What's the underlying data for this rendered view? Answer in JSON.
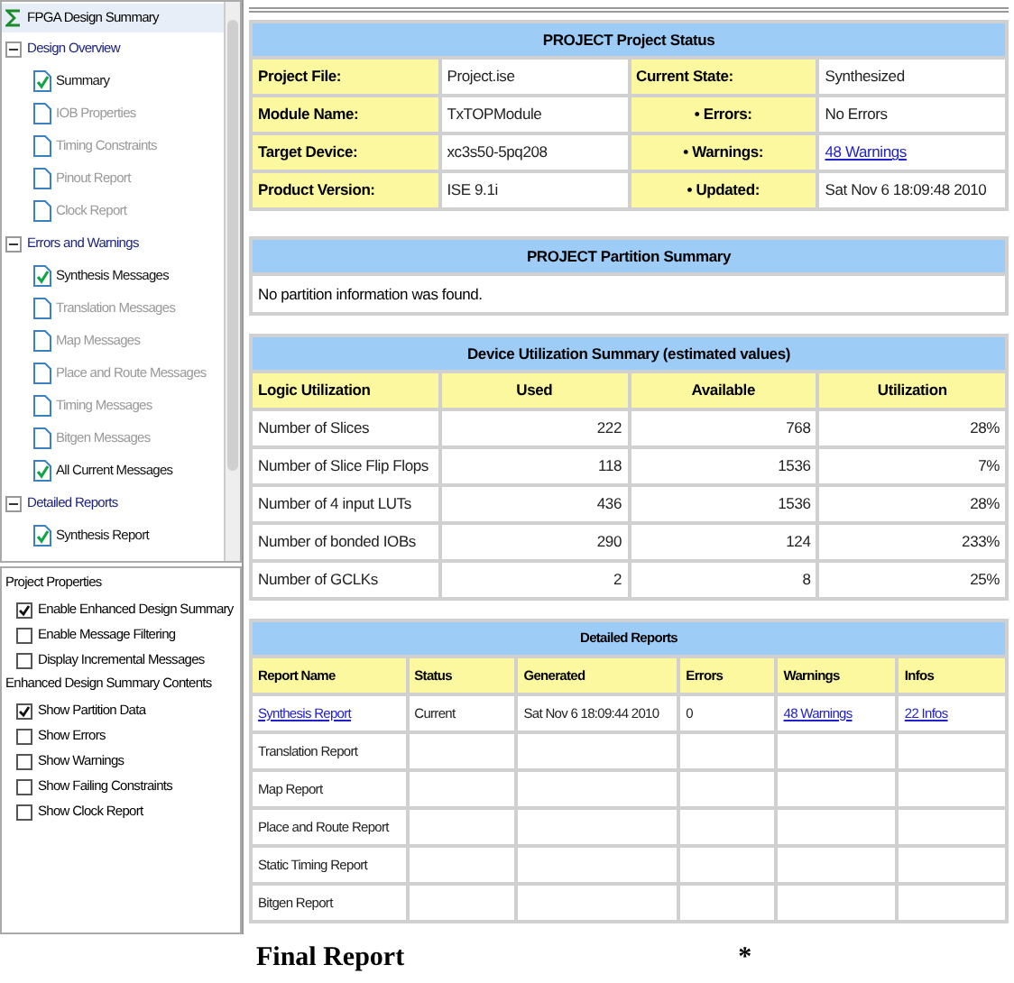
{
  "tree": {
    "header": "FPGA Design Summary",
    "groups": [
      {
        "label": "Design Overview",
        "expanded": true,
        "children": [
          {
            "label": "Summary",
            "checked": true,
            "disabled": false
          },
          {
            "label": "IOB Properties",
            "checked": false,
            "disabled": true
          },
          {
            "label": "Timing Constraints",
            "checked": false,
            "disabled": true
          },
          {
            "label": "Pinout Report",
            "checked": false,
            "disabled": true
          },
          {
            "label": "Clock Report",
            "checked": false,
            "disabled": true
          }
        ]
      },
      {
        "label": "Errors and Warnings",
        "expanded": true,
        "children": [
          {
            "label": "Synthesis Messages",
            "checked": true,
            "disabled": false
          },
          {
            "label": "Translation Messages",
            "checked": false,
            "disabled": true
          },
          {
            "label": "Map Messages",
            "checked": false,
            "disabled": true
          },
          {
            "label": "Place and Route Messages",
            "checked": false,
            "disabled": true
          },
          {
            "label": "Timing Messages",
            "checked": false,
            "disabled": true
          },
          {
            "label": "Bitgen Messages",
            "checked": false,
            "disabled": true
          },
          {
            "label": "All Current Messages",
            "checked": true,
            "disabled": false
          }
        ]
      },
      {
        "label": "Detailed Reports",
        "expanded": true,
        "children": [
          {
            "label": "Synthesis Report",
            "checked": true,
            "disabled": false
          }
        ]
      }
    ]
  },
  "properties": [
    {
      "label": "Project Properties",
      "options": [
        {
          "label": "Enable Enhanced Design Summary",
          "checked": true
        },
        {
          "label": "Enable Message Filtering",
          "checked": false
        },
        {
          "label": "Display Incremental Messages",
          "checked": false
        }
      ]
    },
    {
      "label": "Enhanced Design Summary Contents",
      "options": [
        {
          "label": "Show Partition Data",
          "checked": true
        },
        {
          "label": "Show Errors",
          "checked": false
        },
        {
          "label": "Show Warnings",
          "checked": false
        },
        {
          "label": "Show Failing Constraints",
          "checked": false
        },
        {
          "label": "Show Clock Report",
          "checked": false
        }
      ]
    }
  ],
  "status": {
    "title": "PROJECT Project Status",
    "rows": [
      [
        {
          "text": "Project File:",
          "kind": "label"
        },
        {
          "text": "Project.ise",
          "kind": "text"
        },
        {
          "text": "Current State:",
          "kind": "label"
        },
        {
          "text": "Synthesized",
          "kind": "text"
        }
      ],
      [
        {
          "text": "Module Name:",
          "kind": "label"
        },
        {
          "text": "TxTOPModule",
          "kind": "text"
        },
        {
          "text": "• Errors:",
          "kind": "sublabel"
        },
        {
          "text": "No Errors",
          "kind": "text"
        }
      ],
      [
        {
          "text": "Target Device:",
          "kind": "label"
        },
        {
          "text": "xc3s50-5pq208",
          "kind": "text"
        },
        {
          "text": "• Warnings:",
          "kind": "sublabel"
        },
        {
          "text": "48 Warnings",
          "kind": "link"
        }
      ],
      [
        {
          "text": "Product Version:",
          "kind": "label"
        },
        {
          "text": "ISE 9.1i",
          "kind": "text"
        },
        {
          "text": "• Updated:",
          "kind": "sublabel"
        },
        {
          "text": "Sat Nov 6 18:09:48 2010",
          "kind": "text"
        }
      ]
    ]
  },
  "partition": {
    "title": "PROJECT Partition Summary",
    "message": "No partition information was found."
  },
  "utilization": {
    "title": "Device Utilization Summary (estimated values)",
    "rows": [
      [
        {
          "text": "Logic Utilization",
          "kind": "label"
        },
        {
          "text": "Used",
          "kind": "heading"
        },
        {
          "text": "Available",
          "kind": "heading"
        },
        {
          "text": "Utilization",
          "kind": "heading"
        }
      ],
      [
        {
          "text": "Number of Slices",
          "kind": "text"
        },
        {
          "text": "222",
          "kind": "number"
        },
        {
          "text": "768",
          "kind": "number"
        },
        {
          "text": "28%",
          "kind": "number"
        }
      ],
      [
        {
          "text": "Number of Slice Flip Flops",
          "kind": "text"
        },
        {
          "text": "118",
          "kind": "number"
        },
        {
          "text": "1536",
          "kind": "number"
        },
        {
          "text": "7%",
          "kind": "number"
        }
      ],
      [
        {
          "text": "Number of 4 input LUTs",
          "kind": "text"
        },
        {
          "text": "436",
          "kind": "number"
        },
        {
          "text": "1536",
          "kind": "number"
        },
        {
          "text": "28%",
          "kind": "number"
        }
      ],
      [
        {
          "text": "Number of bonded IOBs",
          "kind": "text"
        },
        {
          "text": "290",
          "kind": "number"
        },
        {
          "text": "124",
          "kind": "number"
        },
        {
          "text": "233%",
          "kind": "number"
        }
      ],
      [
        {
          "text": "Number of GCLKs",
          "kind": "text"
        },
        {
          "text": "2",
          "kind": "number"
        },
        {
          "text": "8",
          "kind": "number"
        },
        {
          "text": "25%",
          "kind": "number"
        }
      ]
    ]
  },
  "reports": {
    "title": "Detailed Reports",
    "rows": [
      [
        {
          "text": "Report Name",
          "kind": "label"
        },
        {
          "text": "Status",
          "kind": "label"
        },
        {
          "text": "Generated",
          "kind": "label"
        },
        {
          "text": "Errors",
          "kind": "label"
        },
        {
          "text": "Warnings",
          "kind": "label"
        },
        {
          "text": "Infos",
          "kind": "label"
        }
      ],
      [
        {
          "text": "Synthesis Report",
          "kind": "link"
        },
        {
          "text": "Current",
          "kind": "text"
        },
        {
          "text": "Sat Nov 6 18:09:44 2010",
          "kind": "text"
        },
        {
          "text": "0",
          "kind": "text"
        },
        {
          "text": "48 Warnings",
          "kind": "link"
        },
        {
          "text": "22 Infos",
          "kind": "link"
        }
      ],
      [
        {
          "text": "Translation Report",
          "kind": "text"
        }
      ],
      [
        {
          "text": "Map Report",
          "kind": "text"
        }
      ],
      [
        {
          "text": "Place and Route Report",
          "kind": "text"
        }
      ],
      [
        {
          "text": "Static Timing Report",
          "kind": "text"
        }
      ],
      [
        {
          "text": "Bitgen Report",
          "kind": "text"
        }
      ]
    ]
  },
  "caption": {
    "text": "Final Report",
    "mark": "*"
  }
}
